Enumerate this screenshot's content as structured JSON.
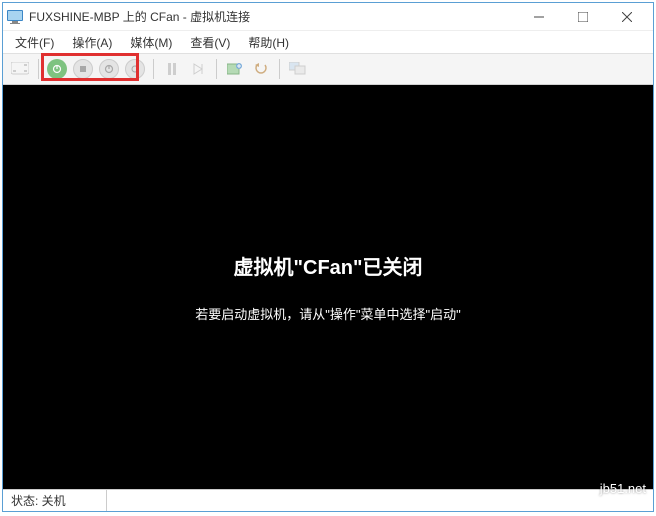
{
  "window": {
    "title": "FUXSHINE-MBP 上的 CFan - 虚拟机连接"
  },
  "menu": {
    "file": "文件(F)",
    "action": "操作(A)",
    "media": "媒体(M)",
    "view": "查看(V)",
    "help": "帮助(H)"
  },
  "toolbar_icons": {
    "ctrl_alt_del": "ctrl-alt-del",
    "start": "start",
    "turnoff": "turnoff",
    "shutdown": "shutdown",
    "save": "save",
    "pause": "pause",
    "reset": "reset",
    "checkpoint": "checkpoint",
    "revert": "revert",
    "enhanced": "enhanced"
  },
  "vm": {
    "heading": "虚拟机\"CFan\"已关闭",
    "message": "若要启动虚拟机，请从\"操作\"菜单中选择\"启动\""
  },
  "status": {
    "label": "状态: 关机"
  },
  "watermark": "jb51.net"
}
